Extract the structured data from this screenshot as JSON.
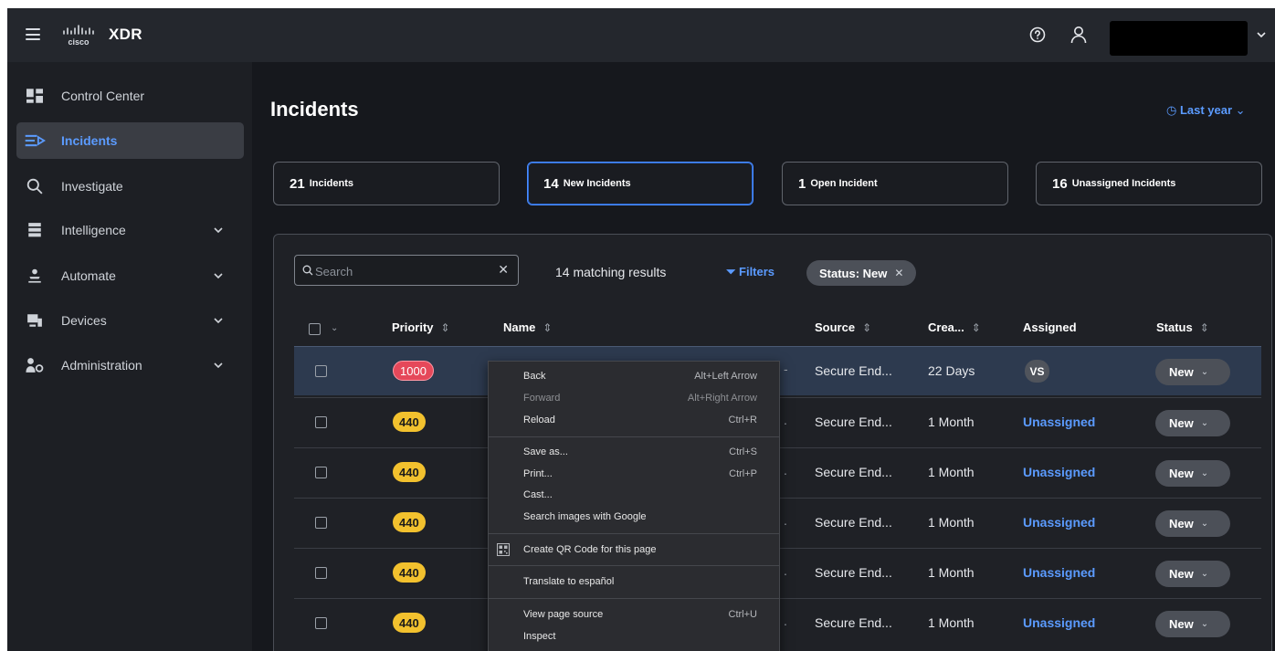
{
  "app": {
    "brand": "cisco",
    "title": "XDR"
  },
  "header": {
    "help_icon": "help-circle-icon",
    "user_icon": "user-icon"
  },
  "sidebar": {
    "items": [
      {
        "label": "Control Center",
        "icon": "dashboard-icon",
        "expandable": false
      },
      {
        "label": "Incidents",
        "icon": "incidents-icon",
        "expandable": false,
        "active": true
      },
      {
        "label": "Investigate",
        "icon": "search-icon",
        "expandable": false
      },
      {
        "label": "Intelligence",
        "icon": "intelligence-icon",
        "expandable": true
      },
      {
        "label": "Automate",
        "icon": "automate-icon",
        "expandable": true
      },
      {
        "label": "Devices",
        "icon": "devices-icon",
        "expandable": true
      },
      {
        "label": "Administration",
        "icon": "administration-icon",
        "expandable": true
      }
    ]
  },
  "main": {
    "title": "Incidents",
    "time_filter": "Last year",
    "stats": [
      {
        "num": "21",
        "label": "Incidents"
      },
      {
        "num": "14",
        "label": "New Incidents",
        "selected": true
      },
      {
        "num": "1",
        "label": "Open Incident"
      },
      {
        "num": "16",
        "label": "Unassigned Incidents"
      }
    ],
    "search": {
      "placeholder": "Search",
      "value": ""
    },
    "match_count": "14 matching results",
    "filters_label": "Filters",
    "filter_chip": "Status: New",
    "columns": {
      "priority": "Priority",
      "name": "Name",
      "source": "Source",
      "created": "Crea...",
      "assigned": "Assigned",
      "status": "Status"
    },
    "rows": [
      {
        "priority": "1000",
        "priority_color": "red",
        "source": "Secure End...",
        "created": "22 Days",
        "assigned": "VS",
        "assigned_type": "avatar",
        "status": "New"
      },
      {
        "priority": "440",
        "priority_color": "yellow",
        "source": "Secure End...",
        "created": "1 Month",
        "assigned": "Unassigned",
        "assigned_type": "link",
        "status": "New"
      },
      {
        "priority": "440",
        "priority_color": "yellow",
        "source": "Secure End...",
        "created": "1 Month",
        "assigned": "Unassigned",
        "assigned_type": "link",
        "status": "New"
      },
      {
        "priority": "440",
        "priority_color": "yellow",
        "source": "Secure End...",
        "created": "1 Month",
        "assigned": "Unassigned",
        "assigned_type": "link",
        "status": "New"
      },
      {
        "priority": "440",
        "priority_color": "yellow",
        "source": "Secure End...",
        "created": "1 Month",
        "assigned": "Unassigned",
        "assigned_type": "link",
        "status": "New"
      },
      {
        "priority": "440",
        "priority_color": "yellow",
        "source": "Secure End...",
        "created": "1 Month",
        "assigned": "Unassigned",
        "assigned_type": "link",
        "status": "New"
      }
    ]
  },
  "context_menu": {
    "items": [
      {
        "label": "Back",
        "shortcut": "Alt+Left Arrow"
      },
      {
        "label": "Forward",
        "shortcut": "Alt+Right Arrow",
        "disabled": true
      },
      {
        "label": "Reload",
        "shortcut": "Ctrl+R"
      },
      {
        "label": "Save as...",
        "shortcut": "Ctrl+S"
      },
      {
        "label": "Print...",
        "shortcut": "Ctrl+P"
      },
      {
        "label": "Cast..."
      },
      {
        "label": "Search images with Google"
      },
      {
        "label": "Create QR Code for this page",
        "icon": "qr-code-icon"
      },
      {
        "label": "Translate to español"
      },
      {
        "label": "View page source",
        "shortcut": "Ctrl+U"
      },
      {
        "label": "Inspect"
      }
    ]
  },
  "colors": {
    "accent": "#5b9bff",
    "priority_red": "#e5485a",
    "priority_yellow": "#f2c12e",
    "topbar": "#24272d",
    "background": "#16181d"
  }
}
